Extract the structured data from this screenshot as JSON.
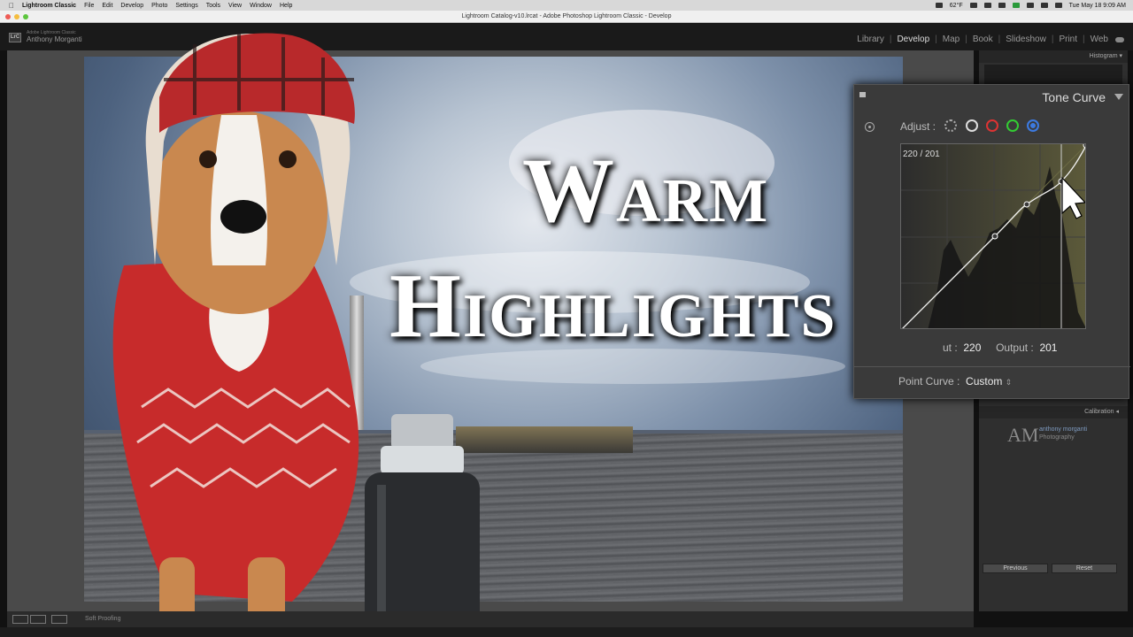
{
  "menubar": {
    "app": "Lightroom Classic",
    "items": [
      "File",
      "Edit",
      "Develop",
      "Photo",
      "Settings",
      "Tools",
      "View",
      "Window",
      "Help"
    ],
    "temperature": "62°F",
    "datetime": "Tue May 18  9:09 AM"
  },
  "window": {
    "title": "Lightroom Catalog-v10.lrcat - Adobe Photoshop Lightroom Classic - Develop"
  },
  "header": {
    "logo": "LrC",
    "brand": "Adobe Lightroom Classic",
    "user": "Anthony Morganti",
    "modules": [
      "Library",
      "Develop",
      "Map",
      "Book",
      "Slideshow",
      "Print",
      "Web"
    ],
    "active_module": "Develop"
  },
  "thumbnail_text": {
    "line1_big": "W",
    "line1_small": "ARM",
    "line2_big": "H",
    "line2_small": "IGHLIGHTS",
    "line2_tail_big": "T",
    "line2_tail_small": "S"
  },
  "right_panel": {
    "histogram_label": "Histogram",
    "calibration_label": "Calibration",
    "watermark_initials": "AM",
    "watermark_line1": "anthony morganti",
    "watermark_line2": "Photography",
    "previous_button": "Previous",
    "reset_button": "Reset"
  },
  "tone_curve": {
    "title": "Tone Curve",
    "adjust_label": "Adjust :",
    "readout": "220 / 201",
    "input_label": "ut :",
    "input_value": "220",
    "output_label": "Output :",
    "output_value": "201",
    "point_curve_label": "Point Curve :",
    "point_curve_value": "Custom",
    "active_channel": "blue",
    "channel_colors": {
      "red": "#dd3333",
      "green": "#33cc33",
      "blue": "#3c7ae0"
    }
  },
  "toolbar": {
    "soft_proofing": "Soft Proofing"
  }
}
